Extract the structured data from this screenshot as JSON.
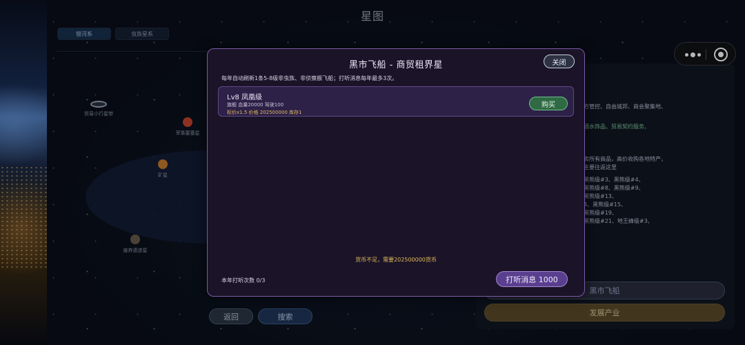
{
  "page": {
    "title": "星图"
  },
  "tabs": [
    {
      "label": "银河系",
      "active": true
    },
    {
      "label": "虫族星系",
      "active": false
    }
  ],
  "map_nodes": [
    {
      "label": "贸易小行星带",
      "kind": "ring"
    },
    {
      "label": "军事要塞星",
      "color": "#c2452e"
    },
    {
      "label": "矿星",
      "color": "#c57a2e"
    },
    {
      "label": "废弃遗迹星",
      "color": "#6a5a4a"
    }
  ],
  "right_panel": {
    "lines": [
      "方管控、自由城邦、商会聚集地、",
      "酒水饰品、贸易契约服务、",
      "卖所有商品，高价收购各地特产，",
      "主要往返这里",
      "黑熊级#3、黑熊级#4、",
      "黑熊级#8、黑熊级#9、",
      "黑熊级#13、",
      "4、黑熊级#15、",
      "黑熊级#19、",
      "黑熊级#21、地王蜂级#3、"
    ],
    "black_market_label": "黑市飞船",
    "develop_label": "发展产业"
  },
  "bottom": {
    "back_label": "返回",
    "search_label": "搜索"
  },
  "capsule": {
    "more_icon": "more-dots-icon",
    "close_icon": "target-close-icon"
  },
  "modal": {
    "title": "黑市飞船 - 商贸租界星",
    "close_label": "关闭",
    "note": "每年自动刷新1条5-8级非虫族、非侦察舰飞船；打听消息每年最多3次。",
    "listing": {
      "name": "Lv8 凤凰级",
      "stats": "旗舰  血量20000  驾驶100",
      "price": "标价x1.5  价格 202500000  库存1",
      "buy_label": "购买"
    },
    "insufficient": "货币不足，需要202500000货币",
    "inquiry_count": "本年打听次数 0/3",
    "inquire_label": "打听消息 1000"
  }
}
